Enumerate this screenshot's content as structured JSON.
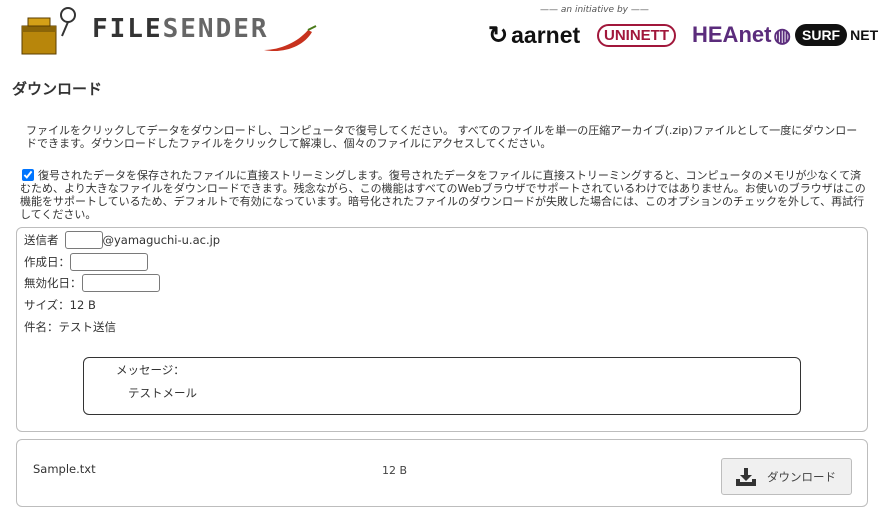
{
  "header": {
    "app_name_part1": "FILE",
    "app_name_part2": "SENDER",
    "initiative": "—— an initiative by ——",
    "partners": [
      "aarnet",
      "UNINETT",
      "HEAnet",
      "SURF",
      "NET"
    ]
  },
  "page": {
    "title": "ダウンロード",
    "info": "ファイルをクリックしてデータをダウンロードし、コンピュータで復号してください。 すべてのファイルを単一の圧縮アーカイブ(.zip)ファイルとして一度にダウンロードできます。ダウンロードしたファイルをクリックして解凍し、個々のファイルにアクセスしてください。",
    "stream_checked": true,
    "stream_text": "復号されたデータを保存されたファイルに直接ストリーミングします。復号されたデータをファイルに直接ストリーミングすると、コンピュータのメモリが少なくて済むため、より大きなファイルをダウンロードできます。残念ながら、この機能はすべてのWebブラウザでサポートされているわけではありません。お使いのブラウザはこの機能をサポートしているため、デフォルトで有効になっています。暗号化されたファイルのダウンロードが失敗した場合には、このオプションのチェックを外して、再試行してください。"
  },
  "transfer": {
    "sender_label": "送信者",
    "sender_domain": "@yamaguchi-u.ac.jp",
    "created_label": "作成日：",
    "expires_label": "無効化日：",
    "size_text": "サイズ：12 B",
    "subject_text": "件名：テスト送信",
    "message_label": "メッセージ：",
    "message_text": "テストメール"
  },
  "file": {
    "name": "Sample.txt",
    "size": "12 B",
    "download_label": "ダウンロード"
  },
  "colors": {
    "chili": "#c8321e",
    "uninett": "#a1173b",
    "heanet": "#5b2c7c"
  }
}
